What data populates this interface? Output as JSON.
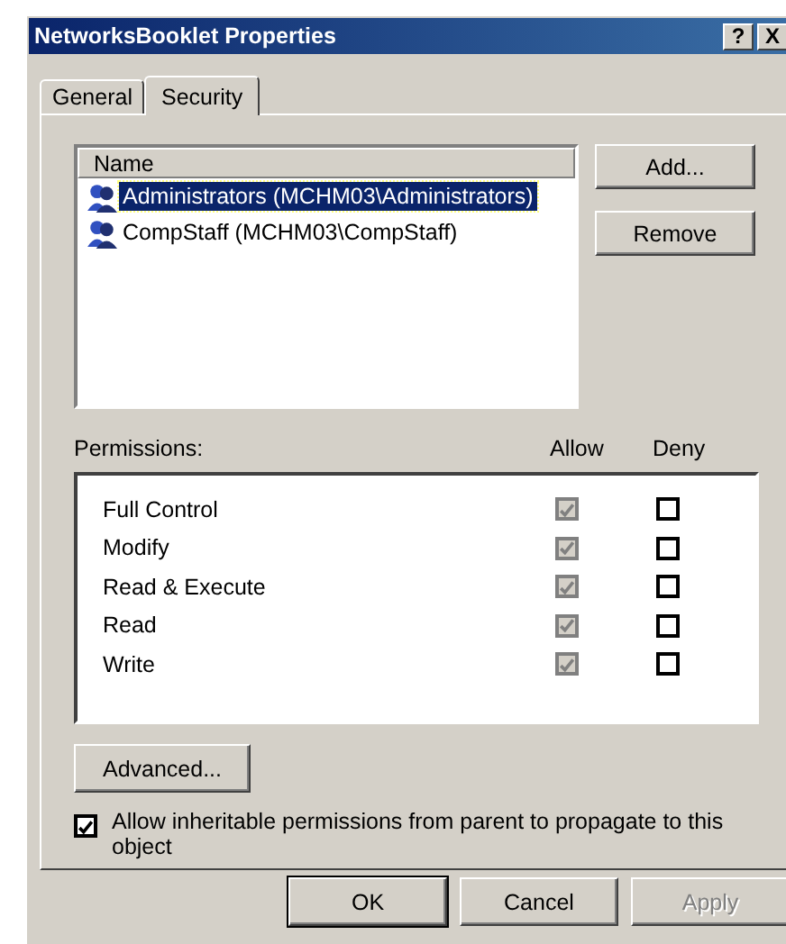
{
  "window": {
    "title": "NetworksBooklet Properties",
    "controls": [
      "?",
      "X"
    ]
  },
  "tabs": [
    {
      "label": "General",
      "selected": false
    },
    {
      "label": "Security",
      "selected": true
    }
  ],
  "users": {
    "column": "Name",
    "rows": [
      {
        "name": "Administrators (MCHM03\\Administrators)",
        "selected": true
      },
      {
        "name": "CompStaff (MCHM03\\CompStaff)",
        "selected": false
      }
    ]
  },
  "user_buttons": [
    "Add...",
    "Remove"
  ],
  "permissions": {
    "label": "Permissions:",
    "allow_header": "Allow",
    "deny_header": "Deny",
    "rows": [
      {
        "name": "Full Control",
        "allow": true,
        "allow_disabled": true,
        "deny": false
      },
      {
        "name": "Modify",
        "allow": true,
        "allow_disabled": true,
        "deny": false
      },
      {
        "name": "Read & Execute",
        "allow": true,
        "allow_disabled": true,
        "deny": false
      },
      {
        "name": "Read",
        "allow": true,
        "allow_disabled": true,
        "deny": false
      },
      {
        "name": "Write",
        "allow": true,
        "allow_disabled": true,
        "deny": false
      }
    ]
  },
  "advanced_button": "Advanced...",
  "inherit": {
    "label": "Allow inheritable permissions from parent to propagate to this object",
    "checked": true
  },
  "buttons": [
    {
      "label": "OK",
      "disabled": false,
      "default": true
    },
    {
      "label": "Cancel",
      "disabled": false,
      "default": false
    },
    {
      "label": "Apply",
      "disabled": true,
      "default": false
    }
  ]
}
